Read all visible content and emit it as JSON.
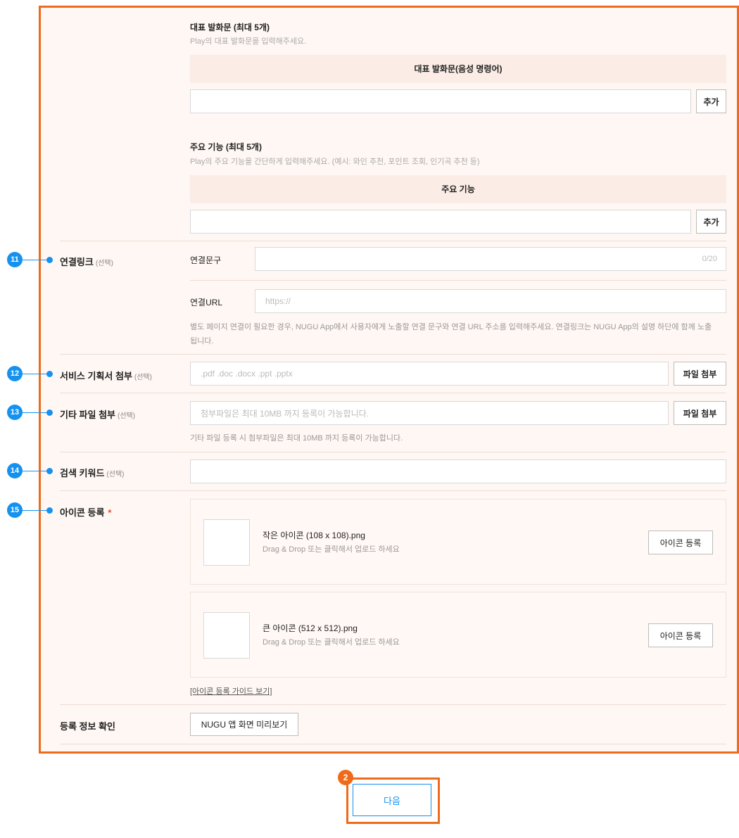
{
  "utterance": {
    "title": "대표 발화문 (최대 5개)",
    "hint": "Play의 대표 발화문을 입력해주세요.",
    "header": "대표 발화문(음성 명령어)",
    "add_label": "추가"
  },
  "features": {
    "title": "주요 기능 (최대 5개)",
    "hint": "Play의 주요 기능을 간단하게 입력해주세요. (예시: 와인 추천, 포인트 조회, 인기곡 추천 등)",
    "header": "주요 기능",
    "add_label": "추가"
  },
  "link": {
    "badge": "11",
    "label": "연결링크",
    "optional": "(선택)",
    "phrase_label": "연결문구",
    "phrase_counter": "0/20",
    "url_label": "연결URL",
    "url_placeholder": "https://",
    "help": "별도 페이지 연결이 필요한 경우, NUGU App에서 사용자에게 노출할 연결 문구와 연결 URL 주소를 입력해주세요. 연결링크는 NUGU App의 설명 하단에 함께 노출",
    "help_cont": "됩니다."
  },
  "plan_doc": {
    "badge": "12",
    "label": "서비스 기획서 첨부",
    "optional": "(선택)",
    "placeholder": ".pdf .doc .docx .ppt .pptx",
    "button": "파일 첨부"
  },
  "etc_file": {
    "badge": "13",
    "label": "기타 파일 첨부",
    "optional": "(선택)",
    "placeholder": "첨부파일은 최대 10MB 까지 등록이 가능합니다.",
    "button": "파일 첨부",
    "help": "기타 파일 등록 시 첨부파일은 최대 10MB 까지 등록이 가능합니다."
  },
  "keyword": {
    "badge": "14",
    "label": "검색 키워드",
    "optional": "(선택)"
  },
  "icons": {
    "badge": "15",
    "label": "아이콘 등록",
    "required_mark": "*",
    "small_name": "작은 아이콘 (108 x 108).png",
    "small_desc": "Drag & Drop 또는 클릭해서 업로드 하세요",
    "small_button": "아이콘 등록",
    "large_name": "큰 아이콘 (512 x 512).png",
    "large_desc": "Drag & Drop 또는 클릭해서 업로드 하세요",
    "large_button": "아이콘 등록",
    "guide_link": "[아이콘 등록 가이드 보기]"
  },
  "confirm": {
    "label": "등록 정보 확인",
    "button": "NUGU 앱 화면 미리보기"
  },
  "next": {
    "badge": "2",
    "label": "다음"
  },
  "colors": {
    "highlight": "#ef6a1a",
    "marker": "#1592ef",
    "panel": "#fff7f3"
  }
}
